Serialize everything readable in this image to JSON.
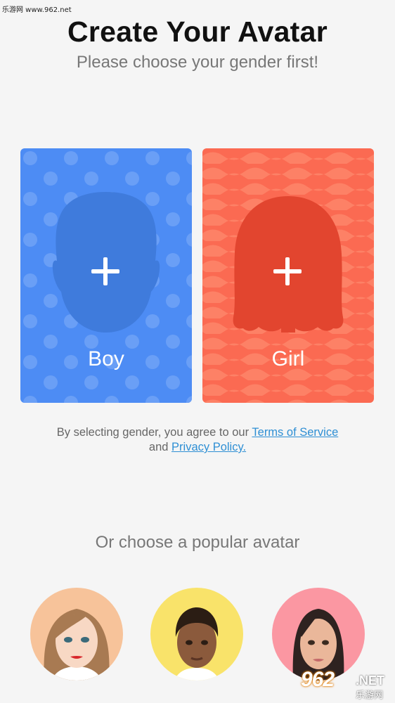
{
  "watermark": {
    "top_text": "乐游网 www.962.net",
    "logo_main": "962",
    "logo_net": ".NET",
    "logo_cn": "乐游网"
  },
  "header": {
    "title": "Create Your Avatar",
    "subtitle": "Please choose your gender first!"
  },
  "gender_cards": {
    "boy": {
      "label": "Boy",
      "color": "#4d8cf4"
    },
    "girl": {
      "label": "Girl",
      "color": "#fb6a52"
    }
  },
  "terms": {
    "prefix": "By selecting gender, you agree to our",
    "terms_link": "Terms of Service",
    "middle": "and",
    "privacy_link": "Privacy Policy."
  },
  "popular": {
    "title": "Or choose a popular avatar",
    "avatars": [
      {
        "name": "blonde-woman-avatar",
        "bg": "#f7c39a"
      },
      {
        "name": "curly-hair-man-avatar",
        "bg": "#f9e36a"
      },
      {
        "name": "dark-hair-woman-avatar",
        "bg": "#fb97a2"
      }
    ]
  }
}
